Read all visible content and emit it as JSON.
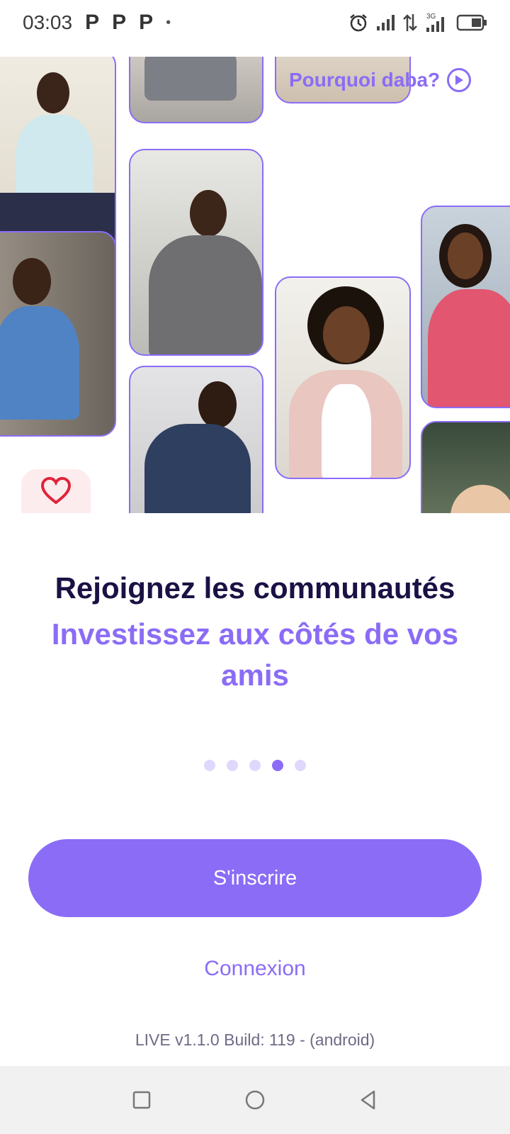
{
  "status_bar": {
    "time": "03:03",
    "notification_icons": [
      "P",
      "P",
      "P",
      "•"
    ],
    "network_label": "3G",
    "icons": [
      "alarm-icon",
      "signal-icon",
      "data-transfer-icon",
      "signal-3g-icon",
      "battery-icon"
    ]
  },
  "header": {
    "why_link": "Pourquoi daba?"
  },
  "onboarding": {
    "title": "Rejoignez les communautés",
    "subtitle": "Investissez aux côtés de vos amis",
    "page_count": 5,
    "active_page": 4
  },
  "actions": {
    "signup_label": "S'inscrire",
    "login_label": "Connexion"
  },
  "footer": {
    "version": "LIVE v1.1.0 Build: 119 - (android)"
  },
  "colors": {
    "accent": "#8b6cf6",
    "title": "#1b1144",
    "heart": "#e0243a"
  }
}
